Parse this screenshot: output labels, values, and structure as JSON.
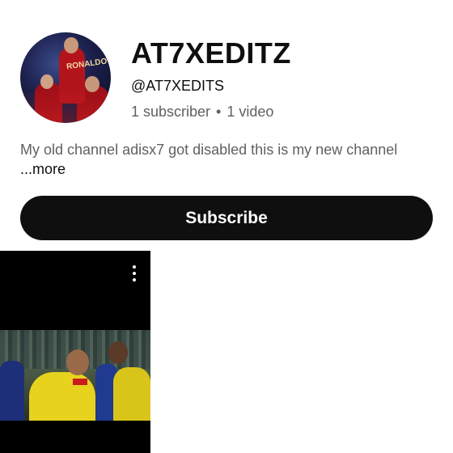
{
  "channel": {
    "name": "AT7XEDITZ",
    "handle": "@AT7XEDITS",
    "subscribers": "1 subscriber",
    "separator": "•",
    "videos": "1 video",
    "description": "My old channel adisx7 got disabled this is my new channel",
    "more_label": "...more",
    "avatar_badge": "RONALDO"
  },
  "actions": {
    "subscribe_label": "Subscribe"
  },
  "video_grid": {
    "items": [
      {
        "thumbnail": "football-players-thumbnail",
        "menu_icon": "more-vert-icon"
      }
    ]
  },
  "colors": {
    "subscribe_bg": "#0f0f0f",
    "secondary_text": "#606060",
    "primary_text": "#0f0f0f"
  }
}
